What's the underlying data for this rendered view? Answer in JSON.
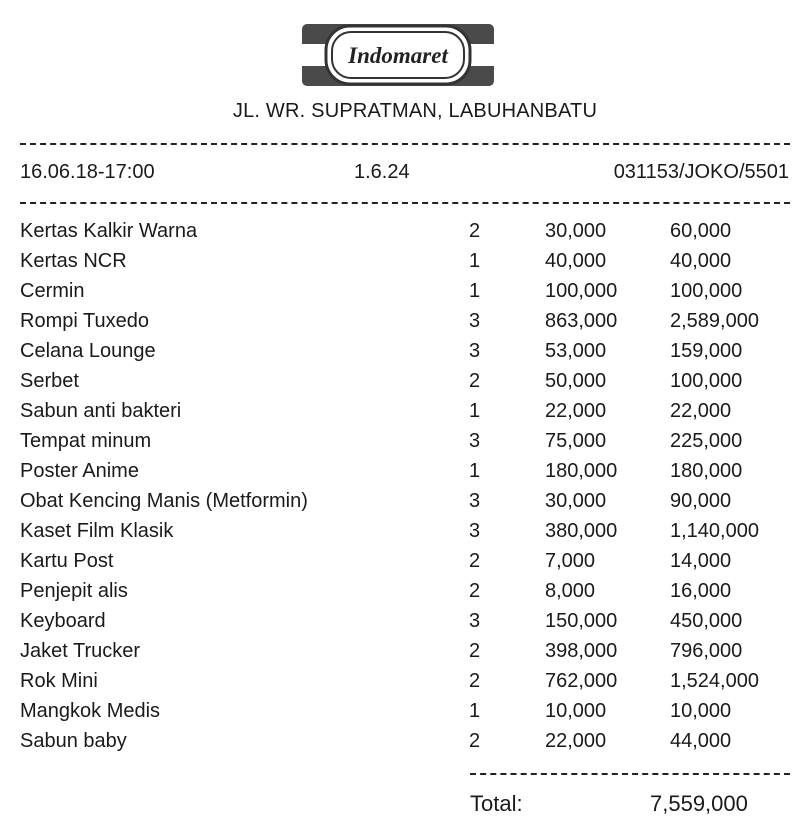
{
  "store": {
    "logo_text": "Indomaret",
    "address": "JL. WR. SUPRATMAN, LABUHANBATU"
  },
  "meta": {
    "datetime": "16.06.18-17:00",
    "version": "1.6.24",
    "transaction": "031153/JOKO/5501"
  },
  "items": [
    {
      "name": "Kertas Kalkir Warna",
      "qty": "2",
      "price": "30,000",
      "subtotal": "60,000"
    },
    {
      "name": "Kertas NCR",
      "qty": "1",
      "price": "40,000",
      "subtotal": "40,000"
    },
    {
      "name": "Cermin",
      "qty": "1",
      "price": "100,000",
      "subtotal": "100,000"
    },
    {
      "name": "Rompi Tuxedo",
      "qty": "3",
      "price": "863,000",
      "subtotal": "2,589,000"
    },
    {
      "name": "Celana Lounge",
      "qty": "3",
      "price": "53,000",
      "subtotal": "159,000"
    },
    {
      "name": "Serbet",
      "qty": "2",
      "price": "50,000",
      "subtotal": "100,000"
    },
    {
      "name": "Sabun anti bakteri",
      "qty": "1",
      "price": "22,000",
      "subtotal": "22,000"
    },
    {
      "name": "Tempat minum",
      "qty": "3",
      "price": "75,000",
      "subtotal": "225,000"
    },
    {
      "name": "Poster Anime",
      "qty": "1",
      "price": "180,000",
      "subtotal": "180,000"
    },
    {
      "name": "Obat Kencing Manis (Metformin)",
      "qty": "3",
      "price": "30,000",
      "subtotal": "90,000"
    },
    {
      "name": "Kaset Film Klasik",
      "qty": "3",
      "price": "380,000",
      "subtotal": "1,140,000"
    },
    {
      "name": "Kartu Post",
      "qty": "2",
      "price": "7,000",
      "subtotal": "14,000"
    },
    {
      "name": "Penjepit alis",
      "qty": "2",
      "price": "8,000",
      "subtotal": "16,000"
    },
    {
      "name": "Keyboard",
      "qty": "3",
      "price": "150,000",
      "subtotal": "450,000"
    },
    {
      "name": "Jaket Trucker",
      "qty": "2",
      "price": "398,000",
      "subtotal": "796,000"
    },
    {
      "name": "Rok Mini",
      "qty": "2",
      "price": "762,000",
      "subtotal": "1,524,000"
    },
    {
      "name": "Mangkok Medis",
      "qty": "1",
      "price": "10,000",
      "subtotal": "10,000"
    },
    {
      "name": "Sabun baby",
      "qty": "2",
      "price": "22,000",
      "subtotal": "44,000"
    }
  ],
  "summary": {
    "total_label": "Total:",
    "total_value": "7,559,000"
  }
}
